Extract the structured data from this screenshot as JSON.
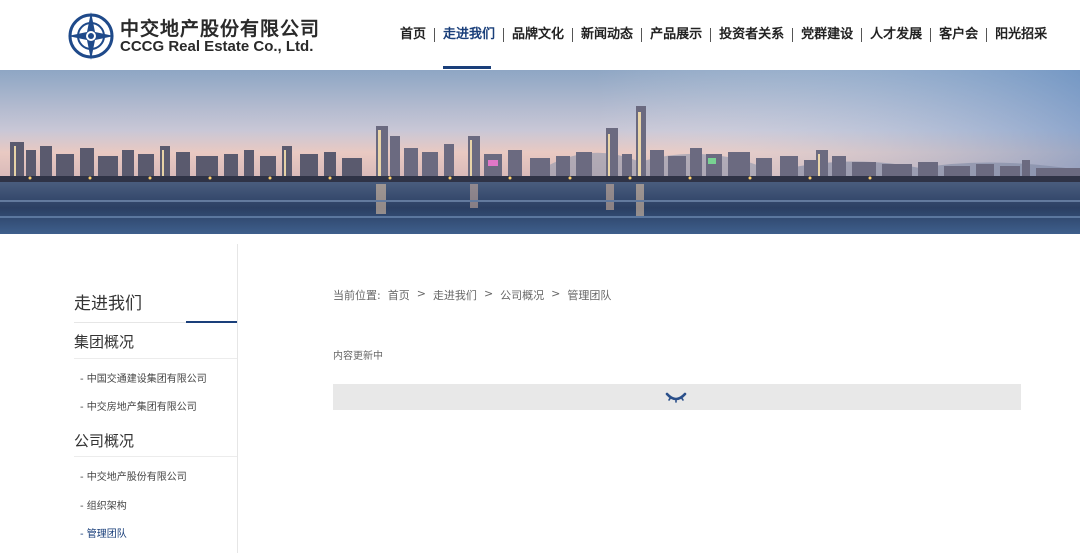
{
  "header": {
    "logo_cn": "中交地产股份有限公司",
    "logo_en": "CCCG Real Estate Co., Ltd.",
    "nav": [
      {
        "label": "首页"
      },
      {
        "label": "走进我们",
        "active": true
      },
      {
        "label": "品牌文化"
      },
      {
        "label": "新闻动态"
      },
      {
        "label": "产品展示"
      },
      {
        "label": "投资者关系"
      },
      {
        "label": "党群建设"
      },
      {
        "label": "人才发展"
      },
      {
        "label": "客户会"
      },
      {
        "label": "阳光招采"
      }
    ]
  },
  "sidebar": {
    "title": "走进我们",
    "groups": [
      {
        "label": "集团概况",
        "links": [
          "中国交通建设集团有限公司",
          "中交房地产集团有限公司"
        ]
      },
      {
        "label": "公司概况",
        "links": [
          "中交地产股份有限公司",
          "组织架构",
          "管理团队"
        ]
      }
    ],
    "active_link": "管理团队"
  },
  "breadcrumb": {
    "prefix": "当前位置:",
    "items": [
      "首页",
      "公司概况",
      "管理团队"
    ],
    "items_full": [
      "首页",
      "走进我们",
      "公司概况",
      "管理团队"
    ],
    "separator": ">"
  },
  "main": {
    "update_note": "内容更新中"
  },
  "colors": {
    "brand": "#1a3f7a",
    "text": "#333333"
  },
  "icons": {
    "logo": "cccg-logo-icon",
    "loader": "spinner-icon"
  }
}
